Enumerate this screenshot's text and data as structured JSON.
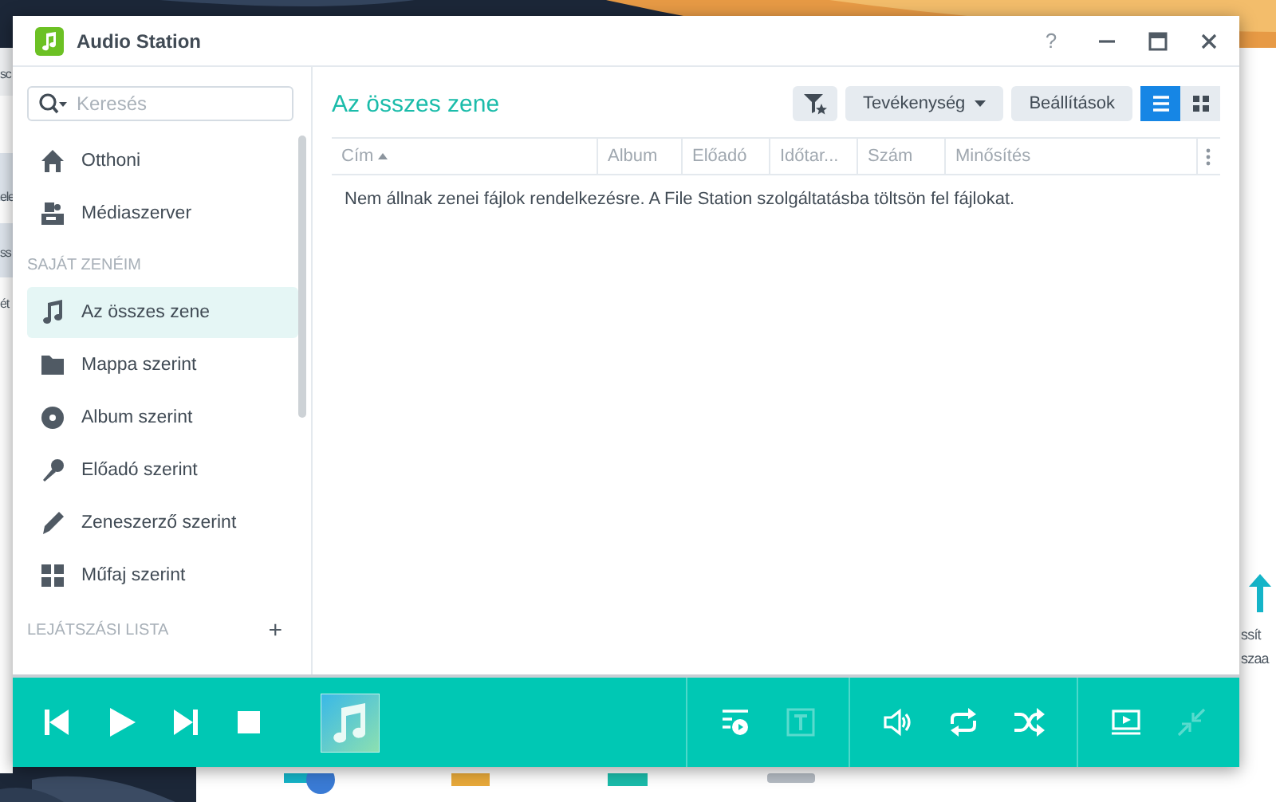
{
  "desktop": {
    "left_window": {
      "texts": [
        "sc",
        "ele",
        "ss",
        "ét"
      ]
    },
    "right_window": {
      "texts": [
        "ssít",
        "szaa"
      ]
    }
  },
  "window": {
    "title": "Audio Station",
    "help": "?"
  },
  "sidebar": {
    "search": {
      "placeholder": "Keresés"
    },
    "top_items": [
      {
        "label": "Otthoni",
        "selected": false
      },
      {
        "label": "Médiaszerver",
        "selected": false
      }
    ],
    "section": "SAJÁT ZENÉIM",
    "items": [
      {
        "label": "Az összes zene",
        "selected": true
      },
      {
        "label": "Mappa szerint",
        "selected": false
      },
      {
        "label": "Album szerint",
        "selected": false
      },
      {
        "label": "Előadó szerint",
        "selected": false
      },
      {
        "label": "Zeneszerző szerint",
        "selected": false
      },
      {
        "label": "Műfaj szerint",
        "selected": false
      }
    ],
    "playlist_section": "LEJÁTSZÁSI LISTA",
    "add": "+"
  },
  "content": {
    "title": "Az összes zene",
    "toolbar": {
      "activity": "Tevékenység",
      "settings": "Beállítások",
      "views": [
        {
          "kind": "list",
          "selected": true
        },
        {
          "kind": "grid",
          "selected": false
        }
      ]
    },
    "table": {
      "columns": [
        {
          "label": "Cím",
          "sorted": true
        },
        {
          "label": "Album",
          "sorted": false
        },
        {
          "label": "Előadó",
          "sorted": false
        },
        {
          "label": "Időtar...",
          "sorted": false
        },
        {
          "label": "Szám",
          "sorted": false
        },
        {
          "label": "Minősítés",
          "sorted": false
        }
      ],
      "empty_message": "Nem állnak zenei fájlok rendelkezésre. A File Station szolgáltatásba töltsön fel fájlokat."
    }
  },
  "player": {
    "left": [
      {
        "kind": "previous",
        "disabled": false
      },
      {
        "kind": "play",
        "disabled": false
      },
      {
        "kind": "next",
        "disabled": false
      },
      {
        "kind": "stop",
        "disabled": false
      }
    ],
    "groups": [
      [
        {
          "kind": "queue",
          "disabled": false
        },
        {
          "kind": "lyrics",
          "disabled": true
        }
      ],
      [
        {
          "kind": "volume",
          "disabled": false
        },
        {
          "kind": "repeat",
          "disabled": false
        },
        {
          "kind": "shuffle",
          "disabled": false
        }
      ],
      [
        {
          "kind": "screen",
          "disabled": false
        },
        {
          "kind": "collapse",
          "disabled": true
        }
      ]
    ]
  }
}
